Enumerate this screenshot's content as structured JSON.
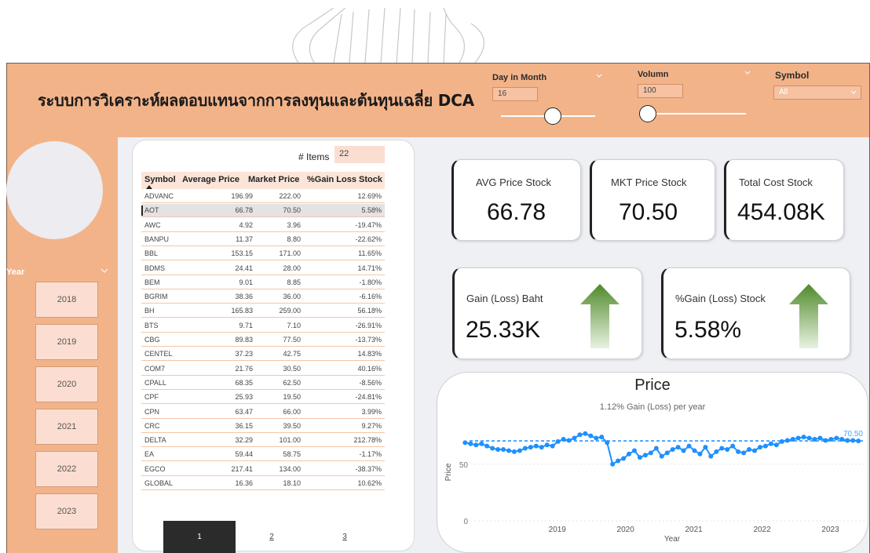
{
  "header": {
    "title": "ระบบการวิเคราะห์ผลตอบแทนจากการลงทุนและต้นทุนเฉลี่ย DCA",
    "day_in_month": {
      "label": "Day in Month",
      "value": "16",
      "slider_fraction": 0.55
    },
    "volumn": {
      "label": "Volumn",
      "value": "100",
      "slider_fraction": 0.0
    },
    "symbol": {
      "label": "Symbol",
      "value": "All"
    }
  },
  "year_filter": {
    "label": "Year",
    "years": [
      "2018",
      "2019",
      "2020",
      "2021",
      "2022",
      "2023"
    ]
  },
  "table": {
    "items_label": "# Items",
    "items_value": "22",
    "columns": [
      "Symbol",
      "Average Price",
      "Market Price",
      "%Gain Loss Stock"
    ],
    "selected_symbol": "AOT",
    "rows": [
      [
        "ADVANC",
        "196.99",
        "222.00",
        "12.69%"
      ],
      [
        "AOT",
        "66.78",
        "70.50",
        "5.58%"
      ],
      [
        "AWC",
        "4.92",
        "3.96",
        "-19.47%"
      ],
      [
        "BANPU",
        "11.37",
        "8.80",
        "-22.62%"
      ],
      [
        "BBL",
        "153.15",
        "171.00",
        "11.65%"
      ],
      [
        "BDMS",
        "24.41",
        "28.00",
        "14.71%"
      ],
      [
        "BEM",
        "9.01",
        "8.85",
        "-1.80%"
      ],
      [
        "BGRIM",
        "38.36",
        "36.00",
        "-6.16%"
      ],
      [
        "BH",
        "165.83",
        "259.00",
        "56.18%"
      ],
      [
        "BTS",
        "9.71",
        "7.10",
        "-26.91%"
      ],
      [
        "CBG",
        "89.83",
        "77.50",
        "-13.73%"
      ],
      [
        "CENTEL",
        "37.23",
        "42.75",
        "14.83%"
      ],
      [
        "COM7",
        "21.76",
        "30.50",
        "40.16%"
      ],
      [
        "CPALL",
        "68.35",
        "62.50",
        "-8.56%"
      ],
      [
        "CPF",
        "25.93",
        "19.50",
        "-24.81%"
      ],
      [
        "CPN",
        "63.47",
        "66.00",
        "3.99%"
      ],
      [
        "CRC",
        "36.15",
        "39.50",
        "9.27%"
      ],
      [
        "DELTA",
        "32.29",
        "101.00",
        "212.78%"
      ],
      [
        "EA",
        "59.44",
        "58.75",
        "-1.17%"
      ],
      [
        "EGCO",
        "217.41",
        "134.00",
        "-38.37%"
      ],
      [
        "GLOBAL",
        "16.36",
        "18.10",
        "10.62%"
      ]
    ],
    "pages": [
      "1",
      "2",
      "3"
    ],
    "active_page": "1"
  },
  "kpis": {
    "avg_price": {
      "label": "AVG Price Stock",
      "value": "66.78"
    },
    "mkt_price": {
      "label": "MKT Price Stock",
      "value": "70.50"
    },
    "total_cost": {
      "label": "Total Cost Stock",
      "value": "454.08K"
    },
    "gain_baht": {
      "label": "Gain (Loss) Baht",
      "value": "25.33K"
    },
    "gain_pct": {
      "label": "%Gain (Loss) Stock",
      "value": "5.58%"
    }
  },
  "colors": {
    "header_bg": "#f3b389",
    "accent_line": "#1e90ff",
    "arrow_green": "#4f8a2a"
  },
  "chart_data": {
    "type": "line",
    "title": "Price",
    "subtitle": "1.12% Gain (Loss) per year",
    "xlabel": "Year",
    "ylabel": "Price",
    "x_ticks": [
      "2019",
      "2020",
      "2021",
      "2022",
      "2023"
    ],
    "y_ticks": [
      "0",
      "50"
    ],
    "ylim": [
      0,
      90
    ],
    "xlim": [
      2018.0,
      2023.9
    ],
    "reference_value": 70.5,
    "end_label": "70.50",
    "series": [
      {
        "x": [
          2018.05,
          2018.13,
          2018.21,
          2018.29,
          2018.37,
          2018.45,
          2018.53,
          2018.61,
          2018.69,
          2018.77,
          2018.85,
          2018.93,
          2019.01,
          2019.09,
          2019.17,
          2019.25,
          2019.33,
          2019.41,
          2019.49,
          2019.57,
          2019.65,
          2019.73,
          2019.81,
          2019.89,
          2019.97,
          2020.05,
          2020.13,
          2020.21,
          2020.29,
          2020.37,
          2020.45,
          2020.53,
          2020.61,
          2020.69,
          2020.77,
          2020.85,
          2020.93,
          2021.01,
          2021.09,
          2021.17,
          2021.25,
          2021.33,
          2021.41,
          2021.49,
          2021.57,
          2021.65,
          2021.73,
          2021.81,
          2021.89,
          2021.97,
          2022.05,
          2022.13,
          2022.21,
          2022.29,
          2022.37,
          2022.45,
          2022.53,
          2022.61,
          2022.69,
          2022.77,
          2022.85,
          2022.93,
          2023.01,
          2023.09,
          2023.17,
          2023.25,
          2023.33,
          2023.41,
          2023.49,
          2023.57,
          2023.65,
          2023.73,
          2023.81
        ],
        "y": [
          69,
          68,
          67,
          68,
          66,
          64,
          63,
          63,
          62,
          61,
          62,
          64,
          65,
          66,
          65,
          67,
          66,
          70,
          72,
          71,
          73,
          76,
          77,
          75,
          73,
          74,
          69,
          50,
          53,
          55,
          59,
          62,
          56,
          58,
          60,
          64,
          57,
          60,
          63,
          65,
          62,
          66,
          62,
          59,
          65,
          57,
          61,
          64,
          63,
          66,
          61,
          60,
          63,
          62,
          65,
          66,
          68,
          67,
          70,
          71,
          72,
          73,
          74,
          73,
          72,
          73,
          71,
          72,
          73,
          72,
          71,
          71,
          70.5
        ]
      }
    ]
  }
}
